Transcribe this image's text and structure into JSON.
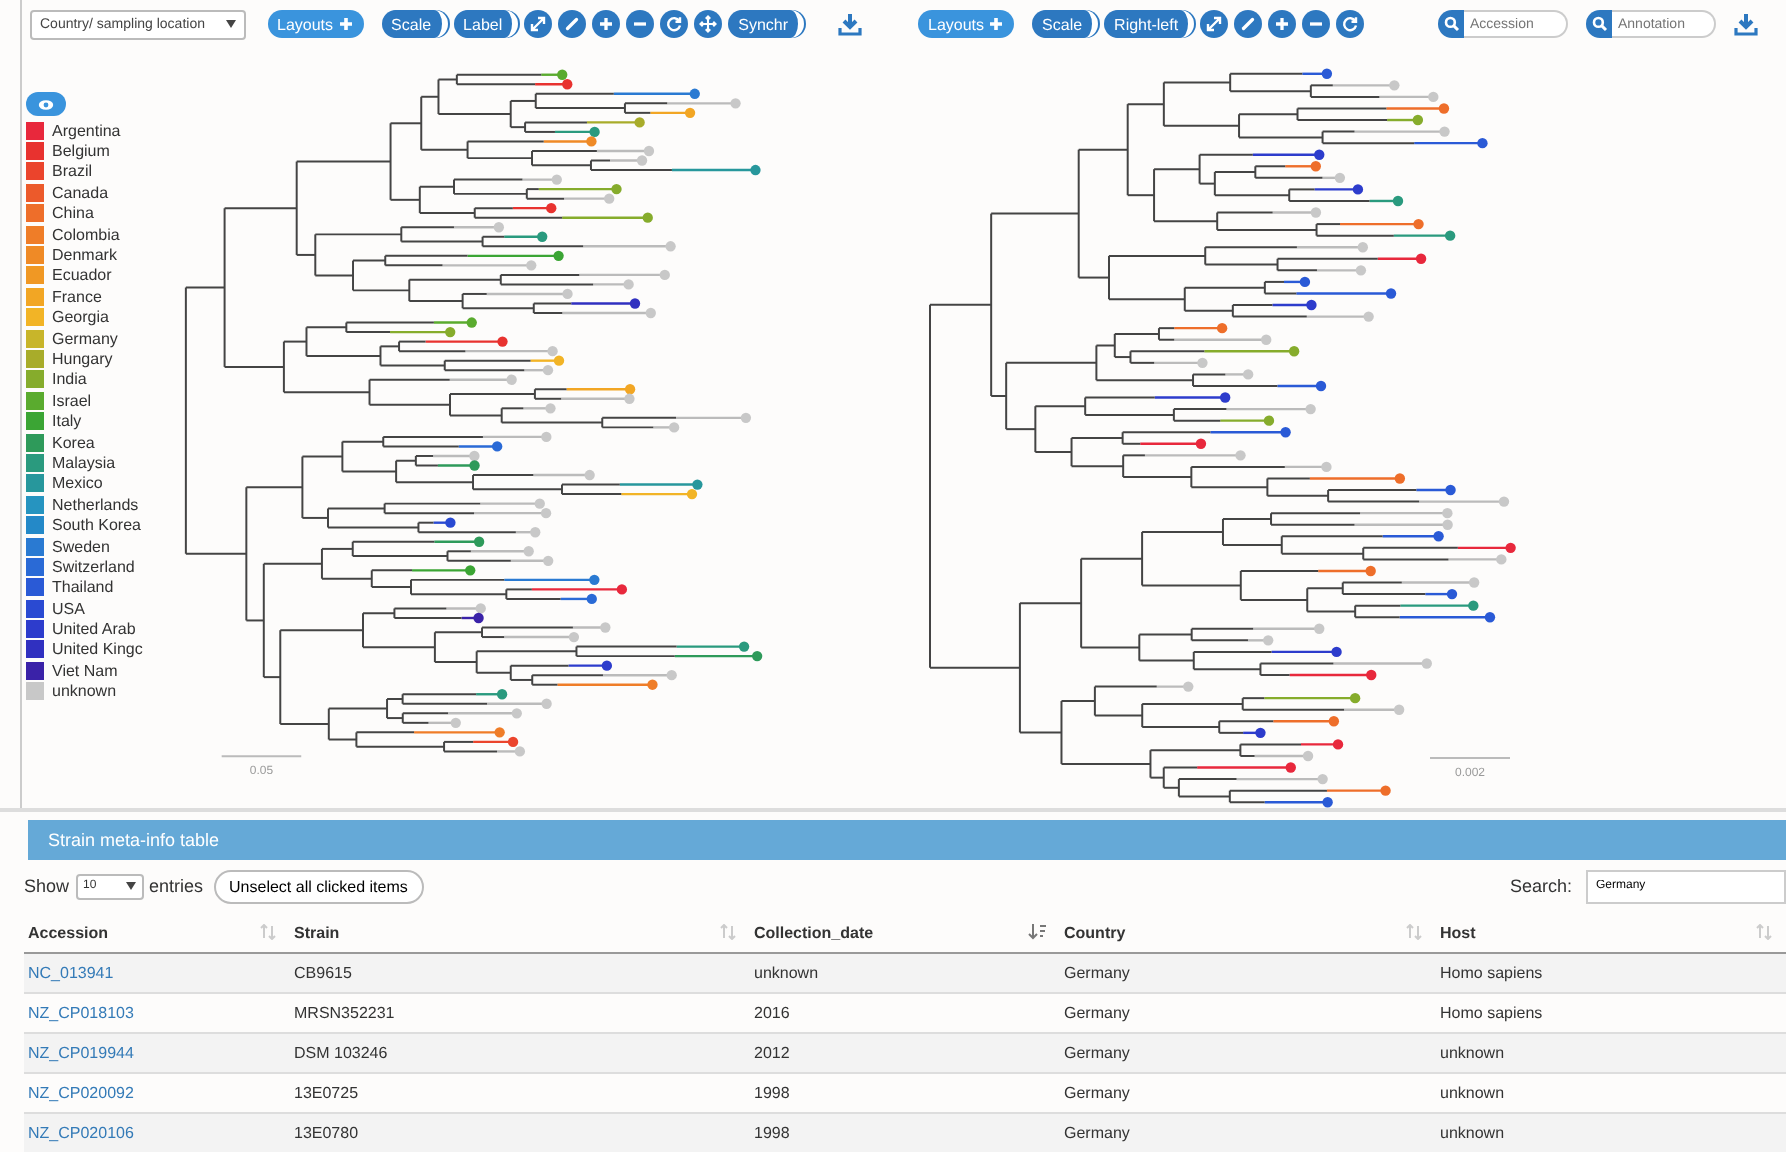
{
  "left_panel": {
    "color_by": {
      "value": "Country/ sampling location"
    },
    "toolbar": [
      {
        "kind": "layouts",
        "label": "Layouts"
      },
      {
        "kind": "toggle",
        "label": "Scale"
      },
      {
        "kind": "toggle",
        "label": "Label"
      },
      {
        "kind": "expand"
      },
      {
        "kind": "pen"
      },
      {
        "kind": "plus"
      },
      {
        "kind": "minus"
      },
      {
        "kind": "refresh"
      },
      {
        "kind": "move"
      },
      {
        "kind": "toggle",
        "label": "Synchr"
      }
    ],
    "legend": [
      {
        "name": "Argentina",
        "color": "#e8283c"
      },
      {
        "name": "Belgium",
        "color": "#e8322f"
      },
      {
        "name": "Brazil",
        "color": "#eb442c"
      },
      {
        "name": "Canada",
        "color": "#ec5a2b"
      },
      {
        "name": "China",
        "color": "#ee6e2a"
      },
      {
        "name": "Colombia",
        "color": "#ef7d28"
      },
      {
        "name": "Denmark",
        "color": "#ef8a26"
      },
      {
        "name": "Ecuador",
        "color": "#f09824"
      },
      {
        "name": "France",
        "color": "#f2a624"
      },
      {
        "name": "Georgia",
        "color": "#f2b426"
      },
      {
        "name": "Germany",
        "color": "#c8b52a"
      },
      {
        "name": "Hungary",
        "color": "#a8ac2a"
      },
      {
        "name": "India",
        "color": "#86ac2c"
      },
      {
        "name": "Israel",
        "color": "#5aab2e"
      },
      {
        "name": "Italy",
        "color": "#3ba534"
      },
      {
        "name": "Korea",
        "color": "#2e9a5a"
      },
      {
        "name": "Malaysia",
        "color": "#2a9a7e"
      },
      {
        "name": "Mexico",
        "color": "#27979c"
      },
      {
        "name": "Netherlands",
        "color": "#2694c0"
      },
      {
        "name": "South Korea",
        "color": "#2489c8"
      },
      {
        "name": "Sweden",
        "color": "#2a7ad2"
      },
      {
        "name": "Switzerland",
        "color": "#2a6ad6"
      },
      {
        "name": "Thailand",
        "color": "#2a5ad6"
      },
      {
        "name": "USA",
        "color": "#2a4ad2"
      },
      {
        "name": "United Arab",
        "color": "#2d3ccc"
      },
      {
        "name": "United Kingc",
        "color": "#3030c0"
      },
      {
        "name": "Viet Nam",
        "color": "#3a22a8"
      },
      {
        "name": "unknown",
        "color": "#c8c8c8"
      }
    ],
    "scale_label": "0.05"
  },
  "right_panel": {
    "toolbar": [
      {
        "kind": "layouts",
        "label": "Layouts"
      },
      {
        "kind": "toggle",
        "label": "Scale"
      },
      {
        "kind": "toggle",
        "label": "Right-left"
      },
      {
        "kind": "expand"
      },
      {
        "kind": "pen"
      },
      {
        "kind": "plus"
      },
      {
        "kind": "minus"
      },
      {
        "kind": "refresh"
      }
    ],
    "search_fields": [
      {
        "placeholder": "Accession"
      },
      {
        "placeholder": "Annotation"
      }
    ],
    "scale_label": "0.002"
  },
  "table": {
    "title": "Strain meta-info table",
    "show_label": "Show",
    "page_size": "10",
    "entries_label": "entries",
    "unselect_button": "Unselect all clicked items",
    "search_label": "Search:",
    "search_value": "Germany",
    "columns": [
      {
        "label": "Accession",
        "sorted_descending": false
      },
      {
        "label": "Strain",
        "sorted_descending": false
      },
      {
        "label": "Collection_date",
        "sorted_descending": true
      },
      {
        "label": "Country",
        "sorted_descending": false
      },
      {
        "label": "Host",
        "sorted_descending": false
      }
    ],
    "rows": [
      [
        "NC_013941",
        "CB9615",
        "unknown",
        "Germany",
        "Homo sapiens"
      ],
      [
        "NZ_CP018103",
        "MRSN352231",
        "2016",
        "Germany",
        "Homo sapiens"
      ],
      [
        "NZ_CP019944",
        "DSM 103246",
        "2012",
        "Germany",
        "unknown"
      ],
      [
        "NZ_CP020092",
        "13E0725",
        "1998",
        "Germany",
        "unknown"
      ],
      [
        "NZ_CP020106",
        "13E0780",
        "1998",
        "Germany",
        "unknown"
      ]
    ]
  }
}
